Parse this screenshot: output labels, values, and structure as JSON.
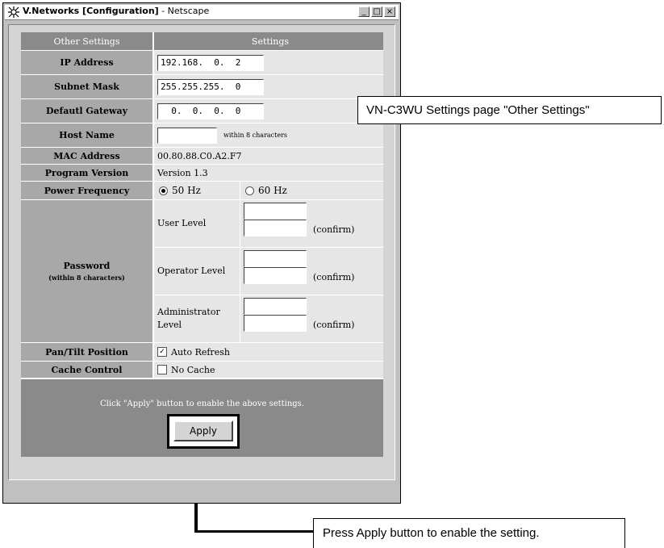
{
  "window": {
    "title_app": "V.Networks",
    "title_page": " [Configuration]",
    "title_browser": " - Netscape",
    "controls": [
      "_",
      "□",
      "×"
    ]
  },
  "table": {
    "header": {
      "left": "Other Settings",
      "right": "Settings"
    },
    "ip_address": {
      "label": "IP Address",
      "value": "192.168.  0.  2"
    },
    "subnet_mask": {
      "label": "Subnet Mask",
      "value": "255.255.255.  0"
    },
    "default_gateway": {
      "label": "Defautl Gateway",
      "value": "  0.  0.  0.  0"
    },
    "host_name": {
      "label": "Host Name",
      "value": "",
      "note": "within 8 characters"
    },
    "mac_address": {
      "label": "MAC Address",
      "value": "00.80.88.C0.A2.F7"
    },
    "program_version": {
      "label": "Program Version",
      "value": "Version 1.3"
    },
    "power_frequency": {
      "label": "Power Frequency",
      "option1": "50 Hz",
      "option2": "60 Hz",
      "selected": "50 Hz"
    },
    "password": {
      "label": "Password",
      "sublabel": "(within 8 characters)",
      "confirm": "(confirm)",
      "levels": [
        "User Level",
        "Operator Level",
        "Administrator Level"
      ]
    },
    "pan_tilt": {
      "label": "Pan/Tilt Position",
      "option": "Auto Refresh",
      "checked": true
    },
    "cache_control": {
      "label": "Cache Control",
      "option": "No Cache",
      "checked": false
    },
    "footer_message": "Click \"Apply\" button to enable the above settings.",
    "apply_label": "Apply"
  },
  "callouts": {
    "settings_page": "VN-C3WU Settings page \"Other Settings\"",
    "apply_note": "Press Apply button to enable the setting."
  },
  "colors": {
    "label_bg": "#a8a8a8",
    "header_bg": "#8a8a8a",
    "value_bg": "#e6e6e6"
  }
}
